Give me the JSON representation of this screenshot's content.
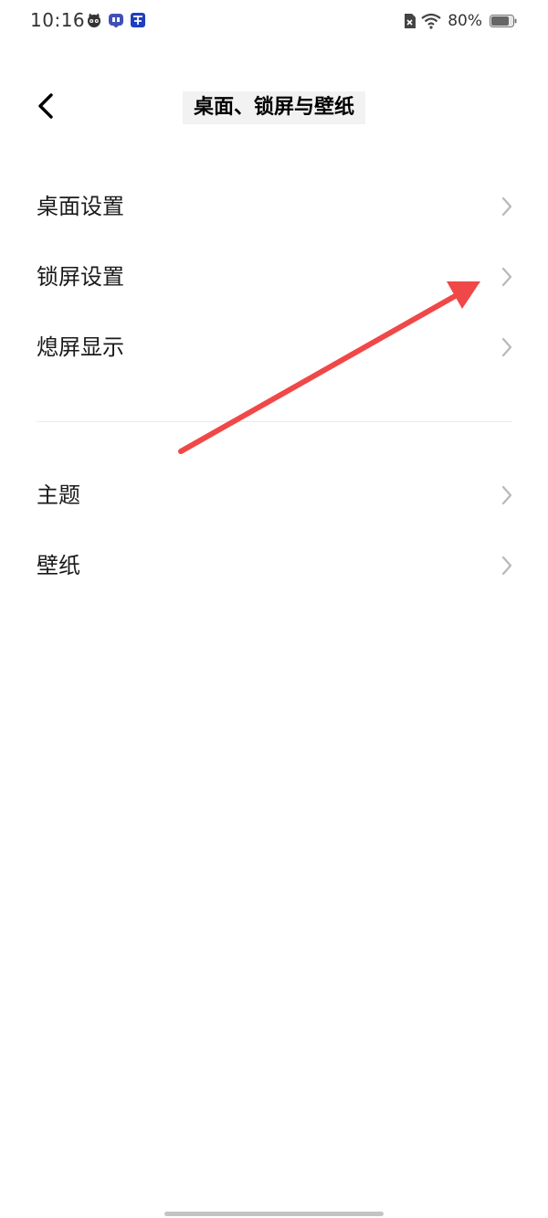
{
  "status_bar": {
    "time": "10:16",
    "battery": "80%",
    "notification_icons": [
      "cat-app-icon",
      "tieba-icon",
      "app-blue-icon"
    ],
    "colors": {
      "tieba": "#3f51b5",
      "app_blue": "#1e3fbf"
    }
  },
  "header": {
    "title": "桌面、锁屏与壁纸",
    "back_icon": "chevron-left-icon"
  },
  "groups": [
    {
      "items": [
        {
          "label": "桌面设置",
          "icon": "chevron-right-icon"
        },
        {
          "label": "锁屏设置",
          "icon": "chevron-right-icon"
        },
        {
          "label": "熄屏显示",
          "icon": "chevron-right-icon"
        }
      ]
    },
    {
      "items": [
        {
          "label": "主题",
          "icon": "chevron-right-icon"
        },
        {
          "label": "壁纸",
          "icon": "chevron-right-icon"
        }
      ]
    }
  ],
  "annotation": {
    "type": "arrow",
    "color": "#f04848"
  }
}
